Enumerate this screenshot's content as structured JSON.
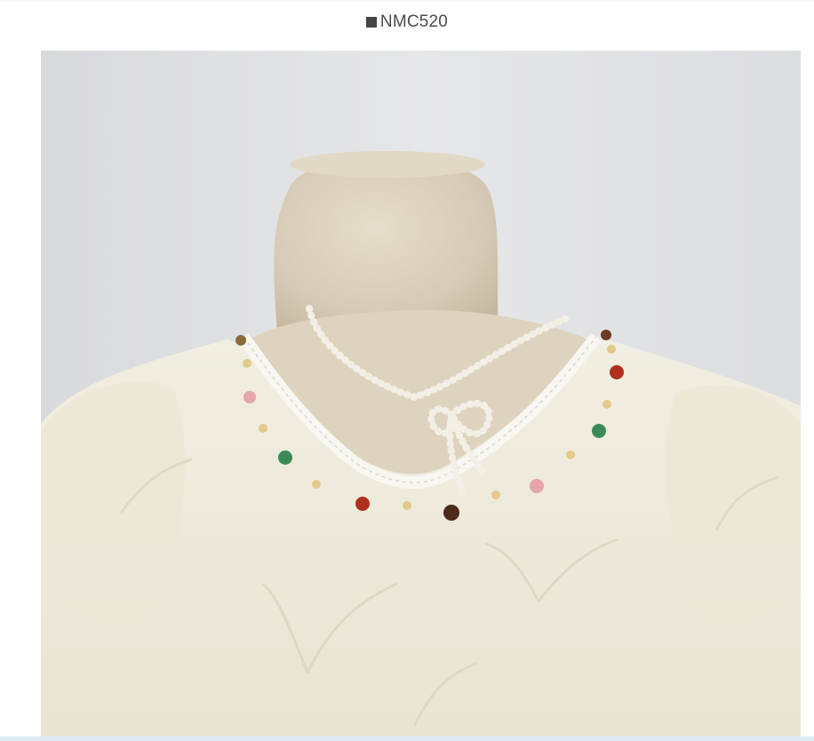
{
  "product": {
    "code": "NMC520"
  },
  "image": {
    "subject": "product-photo",
    "colors": {
      "wall": "#e2e3e5",
      "mannequin": "#d9cfbd",
      "blouse": "#efebdd",
      "lace": "#f7f6f1",
      "pearl": "#f4f1ea"
    }
  }
}
